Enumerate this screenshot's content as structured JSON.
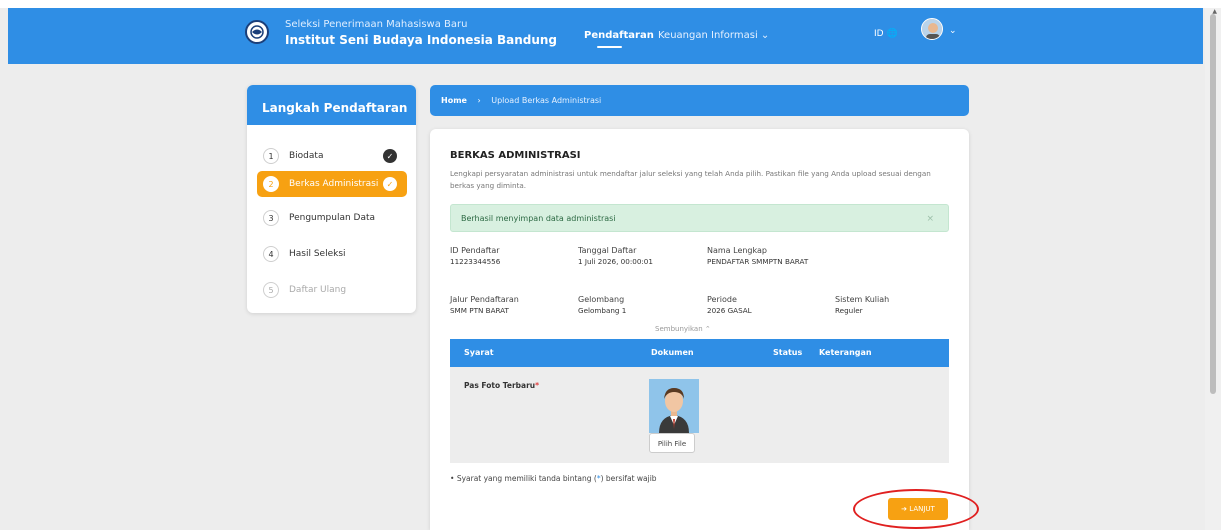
{
  "header": {
    "brand_sub": "Seleksi Penerimaan Mahasiswa Baru",
    "brand_main": "Institut Seni Budaya Indonesia Bandung",
    "nav": [
      {
        "label": "Pendaftaran"
      },
      {
        "label": "Keuangan"
      },
      {
        "label": "Informasi ⌄"
      }
    ],
    "lang": "ID",
    "colors": {
      "primary": "#2f8ee5",
      "accent": "#f7a112"
    }
  },
  "sidebar": {
    "title": "Langkah Pendaftaran",
    "steps": [
      {
        "num": "1",
        "label": "Biodata",
        "state": "done"
      },
      {
        "num": "2",
        "label": "Berkas Administrasi",
        "state": "active"
      },
      {
        "num": "3",
        "label": "Pengumpulan Data",
        "state": "pending"
      },
      {
        "num": "4",
        "label": "Hasil Seleksi",
        "state": "pending"
      },
      {
        "num": "5",
        "label": "Daftar Ulang",
        "state": "disabled"
      }
    ]
  },
  "breadcrumb": {
    "home": "Home",
    "current": "Upload Berkas Administrasi"
  },
  "main": {
    "title": "BERKAS ADMINISTRASI",
    "description": "Lengkapi persyaratan administrasi untuk mendaftar jalur seleksi yang telah Anda pilih. Pastikan file yang Anda upload sesuai dengan berkas yang diminta.",
    "alert": "Berhasil menyimpan data administrasi",
    "alert_close": "×",
    "info_row1": [
      {
        "label": "ID Pendaftar",
        "value": "11223344556"
      },
      {
        "label": "Tanggal Daftar",
        "value": "1 Juli 2026, 00:00:01"
      },
      {
        "label": "Nama Lengkap",
        "value": "PENDAFTAR SMMPTN BARAT"
      }
    ],
    "info_row2": [
      {
        "label": "Jalur Pendaftaran",
        "value": "SMM PTN BARAT"
      },
      {
        "label": "Gelombang",
        "value": "Gelombang 1"
      },
      {
        "label": "Periode",
        "value": "2026 GASAL"
      },
      {
        "label": "Sistem Kuliah",
        "value": "Reguler"
      }
    ],
    "toggle": "Sembunyikan ⌃",
    "table": {
      "headers": [
        "Syarat",
        "Dokumen",
        "Status",
        "Keterangan"
      ],
      "rows": [
        {
          "syarat": "Pas Foto Terbaru",
          "required_mark": "*",
          "button": "Pilih File"
        }
      ]
    },
    "note_prefix": "Syarat yang memiliki tanda bintang (",
    "note_star": "*",
    "note_suffix": ") bersifat wajib",
    "next_button": "➔ LANJUT"
  }
}
